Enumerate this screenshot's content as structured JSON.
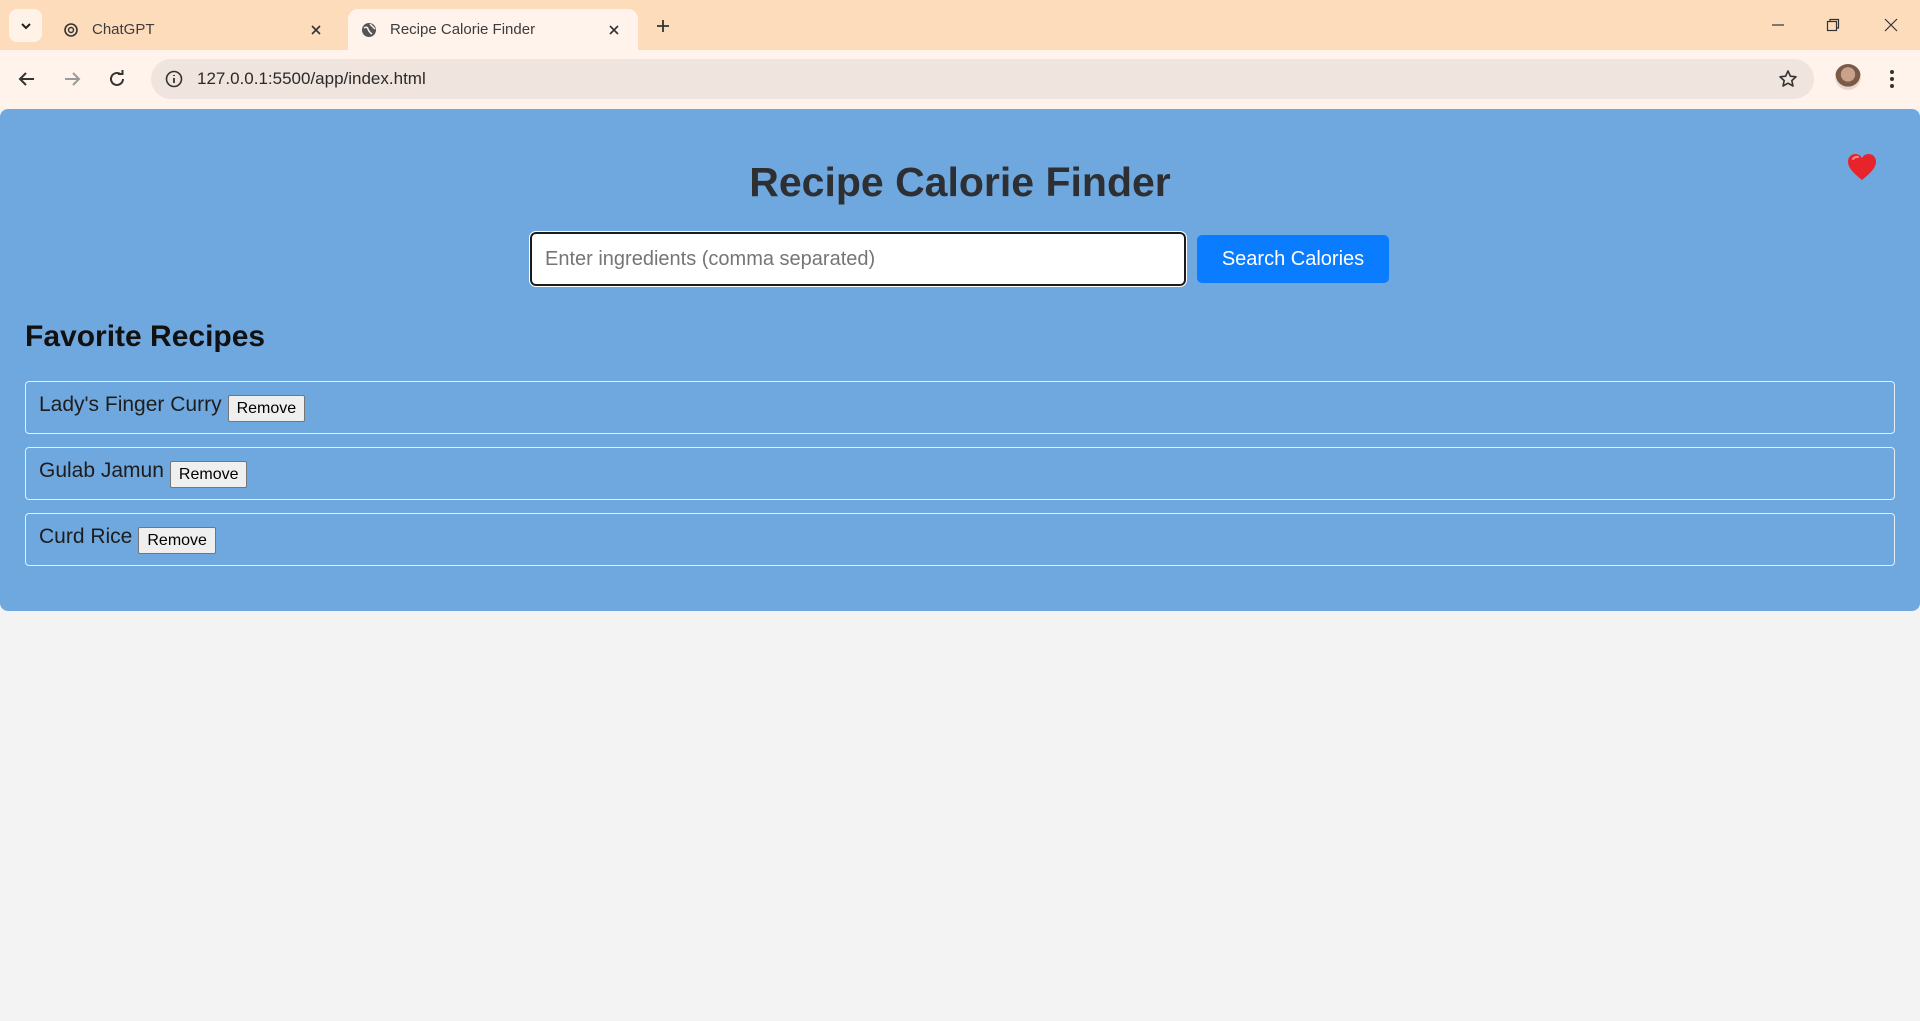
{
  "browser": {
    "tabs": [
      {
        "title": "ChatGPT",
        "active": false
      },
      {
        "title": "Recipe Calorie Finder",
        "active": true
      }
    ],
    "url": "127.0.0.1:5500/app/index.html"
  },
  "app": {
    "title": "Recipe Calorie Finder",
    "search": {
      "placeholder": "Enter ingredients (comma separated)",
      "value": "",
      "button_label": "Search Calories"
    },
    "favorites": {
      "heading": "Favorite Recipes",
      "remove_label": "Remove",
      "items": [
        {
          "name": "Lady's Finger Curry"
        },
        {
          "name": "Gulab Jamun"
        },
        {
          "name": "Curd Rice"
        }
      ]
    },
    "icons": {
      "favorites_toggle": "heart-icon"
    }
  },
  "colors": {
    "tabbar": "#fddcbc",
    "app_background": "#6fa8df",
    "primary_button": "#0a7cff",
    "heart": "#e8232b"
  }
}
